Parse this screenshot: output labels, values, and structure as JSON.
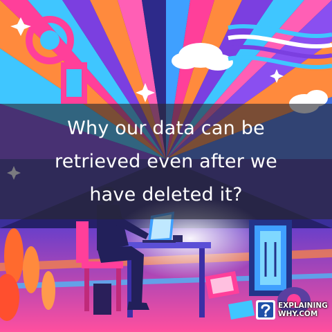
{
  "headline": {
    "line1": "Why our data can be",
    "line2": "retrieved even after we",
    "line3": "have deleted it?"
  },
  "logo": {
    "line1": "EXPLAINING",
    "line2": "WHY.COM"
  },
  "colors": {
    "pink": "#ff3f9a",
    "cyan": "#3fc6ff",
    "purple": "#7b3fe0",
    "orange": "#ff8a3d",
    "navy": "#1b1a4a"
  }
}
